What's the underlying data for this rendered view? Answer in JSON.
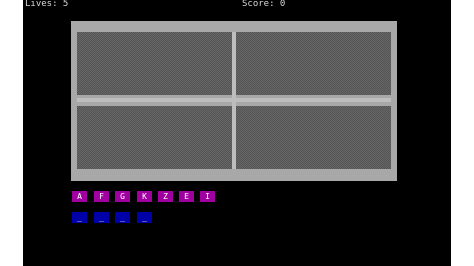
{
  "hud": {
    "lives": "Lives: 5",
    "score": "Score: 0"
  },
  "letters": [
    "A",
    "F",
    "G",
    "K",
    "Z",
    "E",
    "I"
  ],
  "answer_slots": [
    "_",
    "_",
    "_",
    "_"
  ],
  "colors": {
    "background": "#000000",
    "board_frame": "#a8a8a8",
    "panel": "#555555",
    "letter_tile": "#a000a0",
    "answer_tile": "#0000a8",
    "text": "#d8d8d8"
  }
}
